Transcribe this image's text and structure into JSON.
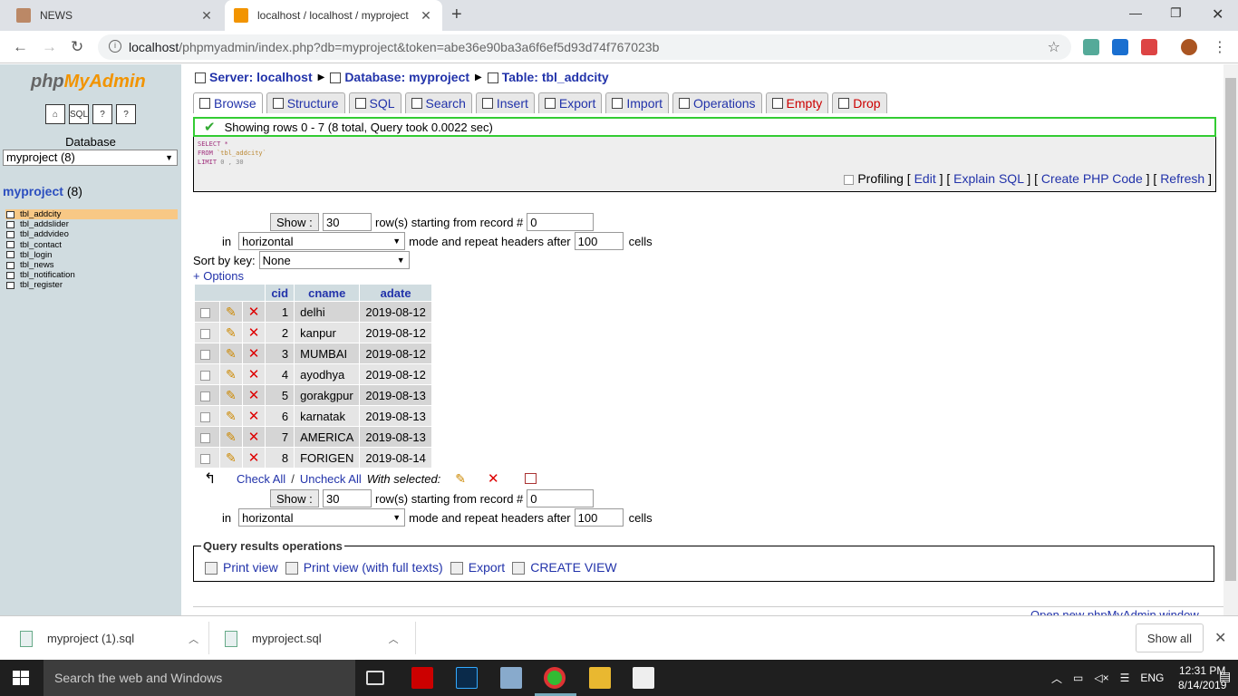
{
  "browser": {
    "tabs": [
      {
        "title": "NEWS",
        "active": false
      },
      {
        "title": "localhost / localhost / myproject",
        "active": true
      }
    ],
    "url_host": "localhost",
    "url_path": "/phpmyadmin/index.php?db=myproject&token=abe36e90ba3a6f6ef5d93d74f767023b"
  },
  "sidebar": {
    "logo_php": "php",
    "logo_admin": "MyAdmin",
    "db_label": "Database",
    "db_select": "myproject (8)",
    "db_name": "myproject",
    "db_count": "(8)",
    "tables": [
      "tbl_addcity",
      "tbl_addslider",
      "tbl_addvideo",
      "tbl_contact",
      "tbl_login",
      "tbl_news",
      "tbl_notification",
      "tbl_register"
    ]
  },
  "breadcrumb": {
    "server": "Server: localhost",
    "database": "Database: myproject",
    "table": "Table: tbl_addcity"
  },
  "tabs": [
    "Browse",
    "Structure",
    "SQL",
    "Search",
    "Insert",
    "Export",
    "Import",
    "Operations",
    "Empty",
    "Drop"
  ],
  "message": "Showing rows 0 - 7 (8 total, Query took 0.0022 sec)",
  "sql": {
    "line1": "SELECT *",
    "line2_kw": "FROM",
    "line2_str": "`tbl_addcity`",
    "line3_kw": "LIMIT",
    "line3_num": "0 , 30",
    "profiling": "Profiling",
    "edit": "Edit",
    "explain": "Explain SQL",
    "php": "Create PHP Code",
    "refresh": "Refresh"
  },
  "nav_form": {
    "show_btn": "Show :",
    "rows": "30",
    "rows_text": "row(s) starting from record #",
    "start": "0",
    "in_text": "in",
    "mode": "horizontal",
    "repeat_text": "mode and repeat headers after",
    "repeat": "100",
    "cells": "cells",
    "sort_label": "Sort by key:",
    "sort_value": "None",
    "options": "+ Options"
  },
  "table": {
    "headers": [
      "cid",
      "cname",
      "adate"
    ],
    "rows": [
      {
        "cid": "1",
        "cname": "delhi",
        "adate": "2019-08-12"
      },
      {
        "cid": "2",
        "cname": "kanpur",
        "adate": "2019-08-12"
      },
      {
        "cid": "3",
        "cname": "MUMBAI",
        "adate": "2019-08-12"
      },
      {
        "cid": "4",
        "cname": "ayodhya",
        "adate": "2019-08-12"
      },
      {
        "cid": "5",
        "cname": "gorakgpur",
        "adate": "2019-08-13"
      },
      {
        "cid": "6",
        "cname": "karnatak",
        "adate": "2019-08-13"
      },
      {
        "cid": "7",
        "cname": "AMERICA",
        "adate": "2019-08-13"
      },
      {
        "cid": "8",
        "cname": "FORIGEN",
        "adate": "2019-08-14"
      }
    ],
    "check_all": "Check All",
    "uncheck_all": "Uncheck All",
    "with_selected": "With selected:"
  },
  "query_ops": {
    "legend": "Query results operations",
    "print": "Print view",
    "print_full": "Print view (with full texts)",
    "export": "Export",
    "create_view": "CREATE VIEW"
  },
  "footer_link": "Open new phpMyAdmin window",
  "downloads": {
    "items": [
      "myproject (1).sql",
      "myproject.sql"
    ],
    "show_all": "Show all"
  },
  "taskbar": {
    "search": "Search the web and Windows",
    "lang": "ENG",
    "time": "12:31 PM",
    "date": "8/14/2019"
  },
  "colors": {
    "link": "#2233aa",
    "sidebar_bg": "#d0dce0",
    "success_border": "#33cc33",
    "delete_red": "#dd0000"
  }
}
